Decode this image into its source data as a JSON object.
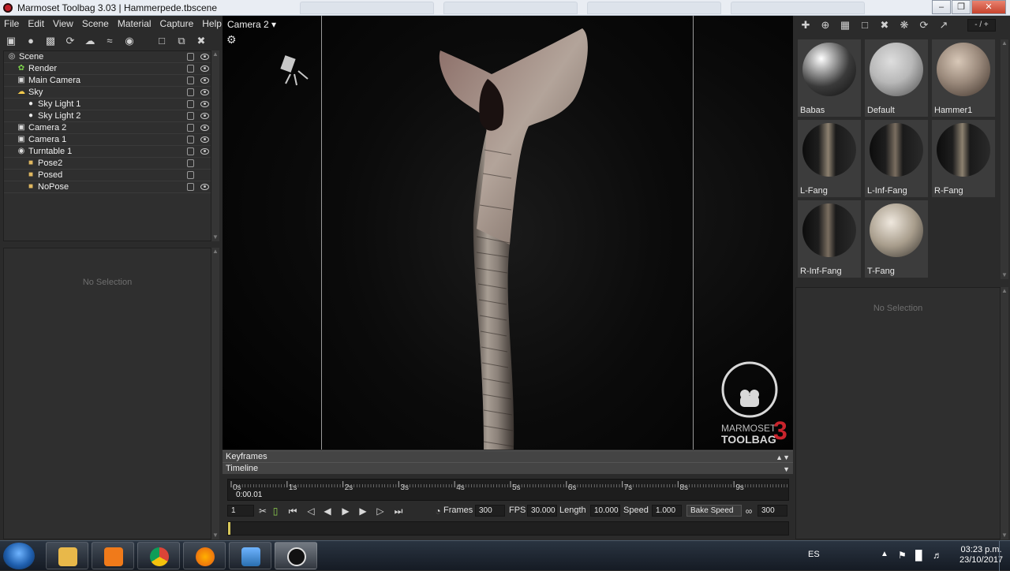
{
  "window": {
    "title": "Marmoset Toolbag 3.03  |  Hammerpede.tbscene",
    "minimize": "–",
    "maximize": "❐",
    "close": "✕"
  },
  "menu": [
    "File",
    "Edit",
    "View",
    "Scene",
    "Material",
    "Capture",
    "Help"
  ],
  "left_toolbar_icons": [
    "cube-icon",
    "light-bulb-icon",
    "camera-icon",
    "turntable-icon",
    "sky-icon",
    "fog-icon",
    "shadow-catcher-icon",
    "folder-icon",
    "duplicate-icon",
    "trash-icon"
  ],
  "scene_tree": [
    {
      "label": "Scene",
      "icon": "scene-icon",
      "depth": 0,
      "eye": true
    },
    {
      "label": "Render",
      "icon": "render-gear-icon",
      "depth": 1,
      "eye": true
    },
    {
      "label": "Main Camera",
      "icon": "camera-icon",
      "depth": 1,
      "eye": true
    },
    {
      "label": "Sky",
      "icon": "sky-icon",
      "depth": 1,
      "eye": true
    },
    {
      "label": "Sky Light 1",
      "icon": "light-bulb-icon",
      "depth": 2,
      "eye": true
    },
    {
      "label": "Sky Light 2",
      "icon": "light-bulb-icon",
      "depth": 2,
      "eye": true
    },
    {
      "label": "Camera 2",
      "icon": "camera-icon",
      "depth": 1,
      "eye": true
    },
    {
      "label": "Camera 1",
      "icon": "camera-icon",
      "depth": 1,
      "eye": true
    },
    {
      "label": "Turntable 1",
      "icon": "turntable-icon",
      "depth": 1,
      "eye": true
    },
    {
      "label": "Pose2",
      "icon": "folder-icon",
      "depth": 2,
      "eye": false
    },
    {
      "label": "Posed",
      "icon": "folder-icon",
      "depth": 2,
      "eye": false
    },
    {
      "label": "NoPose",
      "icon": "folder-icon",
      "depth": 2,
      "eye": true
    }
  ],
  "left_properties": {
    "empty_text": "No Selection"
  },
  "viewport": {
    "camera_label": "Camera 2 ▾",
    "logo_line1": "MARMOSET",
    "logo_line2": "TOOLBAG",
    "logo_version": "3"
  },
  "panels": {
    "keyframes": "Keyframes",
    "timeline": "Timeline"
  },
  "timeline": {
    "ticks": [
      "0s",
      "1s",
      "2s",
      "3s",
      "4s",
      "5s",
      "6s",
      "7s",
      "8s",
      "9s"
    ],
    "current_time": "0:00.01",
    "frame_field": "1",
    "frames_label": "Frames",
    "frames_value": "300",
    "fps_label": "FPS",
    "fps_value": "30.000",
    "length_label": "Length",
    "length_value": "10.000",
    "speed_label": "Speed",
    "speed_value": "1.000",
    "bake_speed_label": "Bake Speed",
    "bake_value": "300"
  },
  "material_toolbar_icons": [
    "add-material-icon",
    "add-from-library-icon",
    "checker-icon",
    "folder-icon",
    "trash-icon",
    "pick-material-icon",
    "refresh-icon",
    "export-icon"
  ],
  "material_pager": "- / +",
  "materials": [
    {
      "name": "Babas",
      "swatch": "#bdbdbd",
      "style": "chrome"
    },
    {
      "name": "Default",
      "swatch": "#b8b8b8",
      "style": "matte"
    },
    {
      "name": "Hammer1",
      "swatch": "#9b8a7c",
      "style": "skin"
    },
    {
      "name": "L-Fang",
      "swatch": "#8d8170",
      "style": "fang"
    },
    {
      "name": "L-Inf-Fang",
      "swatch": "#7a6e60",
      "style": "fang"
    },
    {
      "name": "R-Fang",
      "swatch": "#8d8170",
      "style": "fang"
    },
    {
      "name": "R-Inf-Fang",
      "swatch": "#7a6e60",
      "style": "fang"
    },
    {
      "name": "T-Fang",
      "swatch": "#a89d8c",
      "style": "fang-light"
    }
  ],
  "right_properties": {
    "empty_text": "No Selection"
  },
  "taskbar": {
    "apps": [
      "file-explorer-icon",
      "media-player-icon",
      "chrome-icon",
      "firefox-icon",
      "photo-viewer-icon",
      "marmoset-icon"
    ],
    "language": "ES",
    "time": "03:23 p.m.",
    "date": "23/10/2017"
  }
}
